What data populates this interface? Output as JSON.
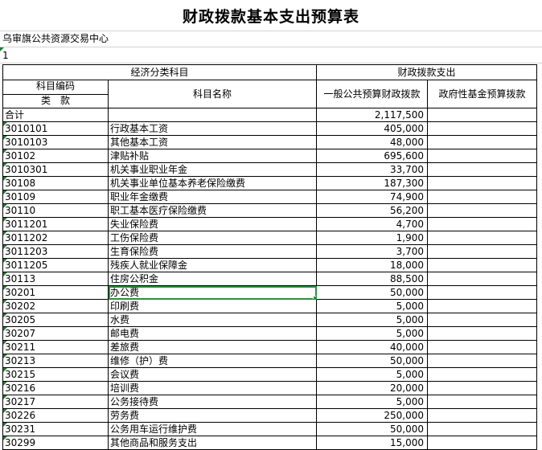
{
  "title": "财政拨款基本支出预算表",
  "unit_name": "乌审旗公共资源交易中心",
  "sheet_no": "1",
  "header": {
    "econ_group": "经济分类科目",
    "fund_group": "财政拨款支出",
    "code_top": "科目编码",
    "code_bottom": "类　款",
    "name": "科目名称",
    "general": "一般公共预算财政拨款",
    "gov_fund": "政府性基金预算拨款"
  },
  "rows": [
    {
      "code": "合计",
      "name": "",
      "general": "2,117,500",
      "fund": ""
    },
    {
      "code": "3010101",
      "name": "行政基本工资",
      "general": "405,000",
      "fund": ""
    },
    {
      "code": "3010103",
      "name": "其他基本工资",
      "general": "48,000",
      "fund": ""
    },
    {
      "code": "30102",
      "name": "津贴补贴",
      "general": "695,600",
      "fund": ""
    },
    {
      "code": "3010301",
      "name": "机关事业职业年金",
      "general": "33,700",
      "fund": ""
    },
    {
      "code": "30108",
      "name": "机关事业单位基本养老保险缴费",
      "general": "187,300",
      "fund": ""
    },
    {
      "code": "30109",
      "name": "职业年金缴费",
      "general": "74,900",
      "fund": ""
    },
    {
      "code": "30110",
      "name": "职工基本医疗保险缴费",
      "general": "56,200",
      "fund": ""
    },
    {
      "code": "3011201",
      "name": "失业保险费",
      "general": "4,700",
      "fund": ""
    },
    {
      "code": "3011202",
      "name": "工伤保险费",
      "general": "1,900",
      "fund": ""
    },
    {
      "code": "3011203",
      "name": "生育保险费",
      "general": "3,700",
      "fund": ""
    },
    {
      "code": "3011205",
      "name": "残疾人就业保障金",
      "general": "18,000",
      "fund": ""
    },
    {
      "code": "30113",
      "name": "住房公积金",
      "general": "88,500",
      "fund": ""
    },
    {
      "code": "30201",
      "name": "办公费",
      "general": "50,000",
      "fund": ""
    },
    {
      "code": "30202",
      "name": "印刷费",
      "general": "5,000",
      "fund": ""
    },
    {
      "code": "30205",
      "name": "水费",
      "general": "5,000",
      "fund": ""
    },
    {
      "code": "30207",
      "name": "邮电费",
      "general": "5,000",
      "fund": ""
    },
    {
      "code": "30211",
      "name": "差旅费",
      "general": "40,000",
      "fund": ""
    },
    {
      "code": "30213",
      "name": "维修（护）费",
      "general": "50,000",
      "fund": ""
    },
    {
      "code": "30215",
      "name": "会议费",
      "general": "5,000",
      "fund": ""
    },
    {
      "code": "30216",
      "name": "培训费",
      "general": "20,000",
      "fund": ""
    },
    {
      "code": "30217",
      "name": "公务接待费",
      "general": "5,000",
      "fund": ""
    },
    {
      "code": "30226",
      "name": "劳务费",
      "general": "250,000",
      "fund": ""
    },
    {
      "code": "30231",
      "name": "公务用车运行维护费",
      "general": "50,000",
      "fund": ""
    },
    {
      "code": "30299",
      "name": "其他商品和服务支出",
      "general": "15,000",
      "fund": ""
    }
  ]
}
